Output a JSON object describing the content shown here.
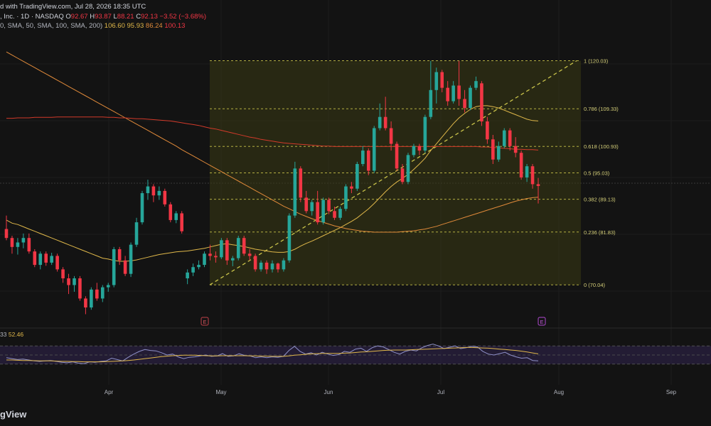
{
  "header": {
    "title_fragment": "d with TradingView.com, Jul 28, 2026 18:35 UTC",
    "symbol_fragment": ", Inc. · 1D · NASDAQ",
    "ohlc": {
      "o_label": "O",
      "o": "92.67",
      "h_label": "H",
      "h": "93.87",
      "l_label": "L",
      "l": "88.21",
      "c_label": "C",
      "c": "92.13",
      "change": "−3.52 (−3.68%)"
    },
    "ma_fragment": "0, SMA, 50, SMA, 100, SMA, 200)",
    "ma_values": [
      "106.60",
      "95.93",
      "86.24",
      "100.13"
    ]
  },
  "rsi": {
    "label_fragment": "33",
    "value": "52.46"
  },
  "footer": {
    "logo_fragment": "gView"
  },
  "x_axis": {
    "ticks": [
      "Apr",
      "May",
      "Jun",
      "Jul",
      "Aug",
      "Sep"
    ]
  },
  "event_markers": [
    "E",
    "E"
  ],
  "colors": {
    "background": "#131313",
    "up": "#26a69a",
    "down": "#f23645",
    "fib_fill": "#3a3a14",
    "fib_line": "#c9c34a",
    "sma50": "#e0b84a",
    "sma100": "#e08a3a",
    "sma200": "#d23a2a",
    "rsi": "#8f91c9",
    "rsi_ma": "#e0b84a"
  },
  "chart_data": {
    "type": "candlestick",
    "price_range": [
      62,
      132
    ],
    "fibonacci": {
      "levels": [
        {
          "ratio": "1",
          "price": 120.03,
          "label": "1 (120.03)"
        },
        {
          "ratio": "0.786",
          "price": 109.33,
          "label": "0.786 (109.33)"
        },
        {
          "ratio": "0.618",
          "price": 100.93,
          "label": "0.618 (100.93)"
        },
        {
          "ratio": "0.5",
          "price": 95.03,
          "label": "0.5 (95.03)"
        },
        {
          "ratio": "0.382",
          "price": 89.13,
          "label": "0.382 (89.13)"
        },
        {
          "ratio": "0.236",
          "price": 81.83,
          "label": "0.236 (81.83)"
        },
        {
          "ratio": "0",
          "price": 70.04,
          "label": "0 (70.04)"
        }
      ]
    },
    "candles": [
      {
        "o": 82.5,
        "h": 85.5,
        "l": 80.0,
        "c": 80.5
      },
      {
        "o": 80.5,
        "h": 81.0,
        "l": 77.0,
        "c": 78.5
      },
      {
        "o": 78.5,
        "h": 80.5,
        "l": 76.8,
        "c": 79.5
      },
      {
        "o": 79.5,
        "h": 81.5,
        "l": 78.2,
        "c": 80.5
      },
      {
        "o": 80.5,
        "h": 81.5,
        "l": 77.0,
        "c": 77.5
      },
      {
        "o": 77.5,
        "h": 78.0,
        "l": 74.0,
        "c": 74.5
      },
      {
        "o": 74.5,
        "h": 77.5,
        "l": 73.5,
        "c": 77.0
      },
      {
        "o": 77.0,
        "h": 77.5,
        "l": 74.3,
        "c": 75.0
      },
      {
        "o": 75.0,
        "h": 77.2,
        "l": 74.5,
        "c": 76.5
      },
      {
        "o": 76.5,
        "h": 77.0,
        "l": 73.0,
        "c": 73.5
      },
      {
        "o": 73.5,
        "h": 74.0,
        "l": 70.5,
        "c": 71.5
      },
      {
        "o": 71.5,
        "h": 72.5,
        "l": 68.0,
        "c": 70.0
      },
      {
        "o": 70.0,
        "h": 72.0,
        "l": 68.5,
        "c": 71.5
      },
      {
        "o": 71.5,
        "h": 72.0,
        "l": 66.5,
        "c": 67.0
      },
      {
        "o": 67.0,
        "h": 67.5,
        "l": 63.5,
        "c": 65.0
      },
      {
        "o": 65.0,
        "h": 69.5,
        "l": 64.5,
        "c": 69.0
      },
      {
        "o": 69.0,
        "h": 70.5,
        "l": 66.5,
        "c": 67.0
      },
      {
        "o": 67.0,
        "h": 70.0,
        "l": 66.2,
        "c": 69.5
      },
      {
        "o": 69.5,
        "h": 70.5,
        "l": 68.5,
        "c": 70.0
      },
      {
        "o": 70.0,
        "h": 78.5,
        "l": 69.5,
        "c": 78.0
      },
      {
        "o": 78.0,
        "h": 78.5,
        "l": 74.5,
        "c": 75.5
      },
      {
        "o": 75.5,
        "h": 76.5,
        "l": 72.0,
        "c": 72.5
      },
      {
        "o": 72.5,
        "h": 79.5,
        "l": 71.8,
        "c": 79.0
      },
      {
        "o": 79.0,
        "h": 85.0,
        "l": 78.5,
        "c": 84.0
      },
      {
        "o": 84.0,
        "h": 91.0,
        "l": 83.5,
        "c": 90.5
      },
      {
        "o": 90.5,
        "h": 93.5,
        "l": 89.0,
        "c": 92.0
      },
      {
        "o": 92.0,
        "h": 92.5,
        "l": 88.5,
        "c": 90.0
      },
      {
        "o": 90.0,
        "h": 92.0,
        "l": 89.0,
        "c": 91.0
      },
      {
        "o": 91.0,
        "h": 91.5,
        "l": 87.5,
        "c": 88.0
      },
      {
        "o": 88.0,
        "h": 88.5,
        "l": 84.0,
        "c": 84.5
      },
      {
        "o": 84.5,
        "h": 86.5,
        "l": 83.8,
        "c": 86.0
      },
      {
        "o": 86.0,
        "h": 86.5,
        "l": 81.5,
        "c": 82.0
      },
      {
        "o": 71.5,
        "h": 73.5,
        "l": 70.2,
        "c": 72.8
      },
      {
        "o": 72.8,
        "h": 74.8,
        "l": 72.0,
        "c": 74.0
      },
      {
        "o": 74.0,
        "h": 75.5,
        "l": 73.5,
        "c": 74.5
      },
      {
        "o": 74.5,
        "h": 77.5,
        "l": 74.0,
        "c": 77.0
      },
      {
        "o": 77.0,
        "h": 79.0,
        "l": 75.5,
        "c": 76.5
      },
      {
        "o": 76.5,
        "h": 77.5,
        "l": 75.0,
        "c": 76.2
      },
      {
        "o": 76.2,
        "h": 80.5,
        "l": 75.8,
        "c": 80.0
      },
      {
        "o": 80.0,
        "h": 80.5,
        "l": 74.5,
        "c": 75.5
      },
      {
        "o": 75.5,
        "h": 76.5,
        "l": 74.2,
        "c": 76.0
      },
      {
        "o": 76.0,
        "h": 81.0,
        "l": 75.5,
        "c": 80.5
      },
      {
        "o": 80.5,
        "h": 81.0,
        "l": 76.5,
        "c": 77.0
      },
      {
        "o": 77.0,
        "h": 78.0,
        "l": 75.5,
        "c": 76.5
      },
      {
        "o": 76.5,
        "h": 77.0,
        "l": 73.0,
        "c": 73.5
      },
      {
        "o": 73.5,
        "h": 75.5,
        "l": 73.0,
        "c": 75.0
      },
      {
        "o": 75.0,
        "h": 75.5,
        "l": 72.5,
        "c": 73.5
      },
      {
        "o": 73.5,
        "h": 75.5,
        "l": 72.8,
        "c": 74.8
      },
      {
        "o": 74.8,
        "h": 75.0,
        "l": 72.8,
        "c": 73.5
      },
      {
        "o": 73.5,
        "h": 76.0,
        "l": 73.0,
        "c": 75.5
      },
      {
        "o": 75.5,
        "h": 86.0,
        "l": 75.0,
        "c": 85.5
      },
      {
        "o": 85.5,
        "h": 97.5,
        "l": 85.0,
        "c": 96.0
      },
      {
        "o": 96.0,
        "h": 96.5,
        "l": 88.5,
        "c": 89.5
      },
      {
        "o": 89.5,
        "h": 91.0,
        "l": 86.0,
        "c": 86.5
      },
      {
        "o": 86.5,
        "h": 89.0,
        "l": 85.5,
        "c": 88.5
      },
      {
        "o": 88.5,
        "h": 91.0,
        "l": 83.5,
        "c": 84.0
      },
      {
        "o": 84.0,
        "h": 89.5,
        "l": 83.5,
        "c": 89.0
      },
      {
        "o": 89.0,
        "h": 89.5,
        "l": 85.8,
        "c": 86.5
      },
      {
        "o": 86.5,
        "h": 87.5,
        "l": 84.5,
        "c": 85.0
      },
      {
        "o": 85.0,
        "h": 87.5,
        "l": 84.5,
        "c": 87.0
      },
      {
        "o": 87.0,
        "h": 92.5,
        "l": 86.5,
        "c": 92.0
      },
      {
        "o": 92.0,
        "h": 93.0,
        "l": 90.5,
        "c": 91.5
      },
      {
        "o": 91.5,
        "h": 97.5,
        "l": 91.0,
        "c": 97.0
      },
      {
        "o": 97.0,
        "h": 101.0,
        "l": 96.5,
        "c": 100.0
      },
      {
        "o": 100.0,
        "h": 100.5,
        "l": 94.5,
        "c": 95.5
      },
      {
        "o": 95.5,
        "h": 105.5,
        "l": 95.0,
        "c": 105.0
      },
      {
        "o": 105.0,
        "h": 110.5,
        "l": 104.5,
        "c": 107.5
      },
      {
        "o": 107.5,
        "h": 112.0,
        "l": 104.5,
        "c": 105.0
      },
      {
        "o": 105.0,
        "h": 106.5,
        "l": 100.0,
        "c": 101.5
      },
      {
        "o": 101.5,
        "h": 102.0,
        "l": 95.5,
        "c": 96.0
      },
      {
        "o": 96.0,
        "h": 97.0,
        "l": 92.5,
        "c": 93.0
      },
      {
        "o": 93.0,
        "h": 99.5,
        "l": 92.5,
        "c": 99.0
      },
      {
        "o": 99.0,
        "h": 101.5,
        "l": 98.5,
        "c": 101.0
      },
      {
        "o": 101.0,
        "h": 101.5,
        "l": 99.0,
        "c": 100.0
      },
      {
        "o": 100.0,
        "h": 108.0,
        "l": 99.5,
        "c": 107.5
      },
      {
        "o": 107.5,
        "h": 120.0,
        "l": 107.0,
        "c": 113.5
      },
      {
        "o": 113.5,
        "h": 118.5,
        "l": 110.5,
        "c": 117.5
      },
      {
        "o": 117.5,
        "h": 118.0,
        "l": 113.0,
        "c": 114.0
      },
      {
        "o": 114.0,
        "h": 115.5,
        "l": 110.0,
        "c": 111.0
      },
      {
        "o": 111.0,
        "h": 115.5,
        "l": 110.5,
        "c": 114.5
      },
      {
        "o": 114.5,
        "h": 120.0,
        "l": 110.0,
        "c": 111.5
      },
      {
        "o": 111.5,
        "h": 113.5,
        "l": 108.5,
        "c": 109.5
      },
      {
        "o": 109.5,
        "h": 114.5,
        "l": 109.0,
        "c": 114.0
      },
      {
        "o": 114.0,
        "h": 116.5,
        "l": 113.5,
        "c": 115.5
      },
      {
        "o": 115.0,
        "h": 115.5,
        "l": 105.5,
        "c": 106.5
      },
      {
        "o": 106.5,
        "h": 107.5,
        "l": 101.5,
        "c": 102.5
      },
      {
        "o": 102.5,
        "h": 103.5,
        "l": 97.0,
        "c": 98.0
      },
      {
        "o": 98.0,
        "h": 102.0,
        "l": 97.5,
        "c": 101.0
      },
      {
        "o": 101.0,
        "h": 105.0,
        "l": 100.5,
        "c": 104.5
      },
      {
        "o": 104.5,
        "h": 105.0,
        "l": 100.0,
        "c": 101.0
      },
      {
        "o": 101.0,
        "h": 103.0,
        "l": 98.5,
        "c": 99.5
      },
      {
        "o": 99.5,
        "h": 100.0,
        "l": 93.5,
        "c": 94.0
      },
      {
        "o": 94.0,
        "h": 97.0,
        "l": 93.0,
        "c": 96.5
      },
      {
        "o": 96.5,
        "h": 97.0,
        "l": 91.5,
        "c": 92.5
      },
      {
        "o": 92.5,
        "h": 93.9,
        "l": 88.2,
        "c": 92.1
      }
    ],
    "sma_series": [
      {
        "name": "SMA 50",
        "values": [
          84.5,
          83.8,
          83.5,
          83,
          82.5,
          82,
          81.5,
          81,
          80.5,
          80,
          79.5,
          79,
          78.5,
          78,
          77.5,
          77,
          76.5,
          76,
          75.8,
          75.5,
          75.3,
          75.3,
          75.4,
          75.6,
          75.9,
          76.2,
          76.5,
          76.8,
          77,
          77.2,
          77.4,
          77.5,
          77.6,
          77.8,
          78,
          78.2,
          78.5,
          78.8,
          79.1,
          79.2,
          79,
          78.8,
          78.6,
          78.3,
          78,
          77.8,
          77.6,
          77.4,
          77.3,
          77.3,
          77.5,
          78,
          78.7,
          79.3,
          79.8,
          80.4,
          81,
          81.6,
          82.2,
          82.8,
          83.5,
          84.2,
          85,
          86,
          87,
          88.2,
          89.5,
          90.8,
          92,
          93,
          93.8,
          94.7,
          95.8,
          97,
          98.3,
          100,
          101.5,
          103,
          104.5,
          106,
          107.3,
          108.3,
          109.2,
          109.8,
          110,
          110,
          109.8,
          109.5,
          109,
          108.5,
          108,
          107.5,
          107,
          106.7,
          106.6
        ]
      },
      {
        "name": "SMA 100",
        "values": [
          122,
          121.3,
          120.6,
          119.9,
          119.2,
          118.5,
          117.8,
          117.1,
          116.4,
          115.7,
          115,
          114.3,
          113.6,
          112.9,
          112.2,
          111.5,
          110.8,
          110.1,
          109.4,
          108.7,
          108,
          107.3,
          106.6,
          105.9,
          105.2,
          104.5,
          103.8,
          103.1,
          102.4,
          101.7,
          101,
          100.2,
          99.5,
          98.8,
          98.1,
          97.4,
          96.7,
          96,
          95.3,
          94.6,
          93.9,
          93.2,
          92.5,
          91.8,
          91.1,
          90.4,
          89.7,
          89,
          88.3,
          87.6,
          87,
          86.4,
          85.8,
          85.3,
          84.8,
          84.4,
          84,
          83.6,
          83.2,
          82.9,
          82.6,
          82.4,
          82.2,
          82,
          81.9,
          81.8,
          81.8,
          81.8,
          81.8,
          81.8,
          81.9,
          82,
          82.1,
          82.3,
          82.5,
          82.8,
          83.1,
          83.5,
          83.9,
          84.3,
          84.7,
          85.1,
          85.5,
          85.9,
          86.3,
          86.7,
          87.1,
          87.5,
          87.9,
          88.3,
          88.7,
          89,
          89.3,
          89.5,
          89.6
        ]
      },
      {
        "name": "SMA 200",
        "values": [
          107.2,
          107.2,
          107.3,
          107.3,
          107.3,
          107.4,
          107.4,
          107.4,
          107.4,
          107.5,
          107.5,
          107.5,
          107.5,
          107.5,
          107.5,
          107.5,
          107.5,
          107.5,
          107.4,
          107.4,
          107.3,
          107.3,
          107.2,
          107.1,
          107.1,
          107,
          106.9,
          106.8,
          106.7,
          106.6,
          106.4,
          106.2,
          106,
          105.8,
          105.6,
          105.3,
          105,
          104.8,
          104.5,
          104.2,
          103.9,
          103.6,
          103.3,
          103,
          102.8,
          102.5,
          102.3,
          102.1,
          101.9,
          101.7,
          101.6,
          101.5,
          101.4,
          101.3,
          101.2,
          101.1,
          101,
          101,
          100.9,
          100.9,
          100.9,
          100.9,
          100.9,
          100.9,
          100.9,
          100.9,
          100.9,
          100.9,
          100.9,
          100.9,
          100.9,
          100.9,
          100.9,
          100.9,
          100.9,
          100.9,
          100.9,
          100.9,
          100.9,
          100.9,
          100.9,
          100.9,
          100.9,
          100.9,
          100.8,
          100.8,
          100.7,
          100.6,
          100.5,
          100.4,
          100.3,
          100.3,
          100.2,
          100.2,
          100.1
        ]
      }
    ],
    "rsi_range": [
      0,
      100
    ],
    "rsi_values": [
      44,
      42,
      40,
      41,
      39,
      37,
      36,
      37,
      38,
      36,
      34,
      33,
      35,
      32,
      31,
      35,
      34,
      36,
      37,
      43,
      40,
      37,
      45,
      52,
      58,
      62,
      60,
      59,
      55,
      50,
      52,
      46,
      42,
      45,
      46,
      48,
      50,
      47,
      48,
      53,
      47,
      48,
      53,
      49,
      48,
      44,
      46,
      44,
      46,
      45,
      47,
      60,
      69,
      58,
      52,
      55,
      50,
      56,
      52,
      49,
      51,
      58,
      56,
      63,
      65,
      58,
      66,
      70,
      68,
      62,
      56,
      52,
      58,
      61,
      59,
      66,
      71,
      74,
      70,
      64,
      67,
      70,
      64,
      66,
      69,
      68,
      58,
      52,
      50,
      53,
      56,
      50,
      46,
      43,
      44,
      38,
      37
    ],
    "rsi_ma_values": [
      39,
      39,
      38.5,
      38,
      38,
      37.5,
      37,
      37,
      37,
      36.5,
      36,
      36,
      35.5,
      35.5,
      35,
      35,
      35,
      35,
      35.5,
      36,
      36.5,
      37,
      38,
      39,
      40.5,
      42,
      43.5,
      45,
      46.5,
      47.5,
      48.5,
      49,
      49.5,
      49.5,
      49.5,
      49,
      48.5,
      48,
      48,
      48.5,
      48.5,
      48.5,
      48.5,
      48.5,
      48,
      48,
      47.5,
      47.5,
      47,
      47,
      47,
      48,
      49.5,
      50.5,
      51.5,
      52.5,
      53,
      53.5,
      53.5,
      53.5,
      53.5,
      54,
      54.5,
      55.5,
      56.5,
      57,
      58,
      59,
      60,
      60.5,
      61,
      61,
      61,
      61.5,
      62,
      62.5,
      63,
      63.5,
      64,
      64.5,
      65,
      65.5,
      66,
      66.5,
      66.5,
      66,
      65.5,
      65,
      64,
      63,
      62,
      61,
      60,
      58.5,
      56.5,
      54.5,
      52.5
    ]
  }
}
